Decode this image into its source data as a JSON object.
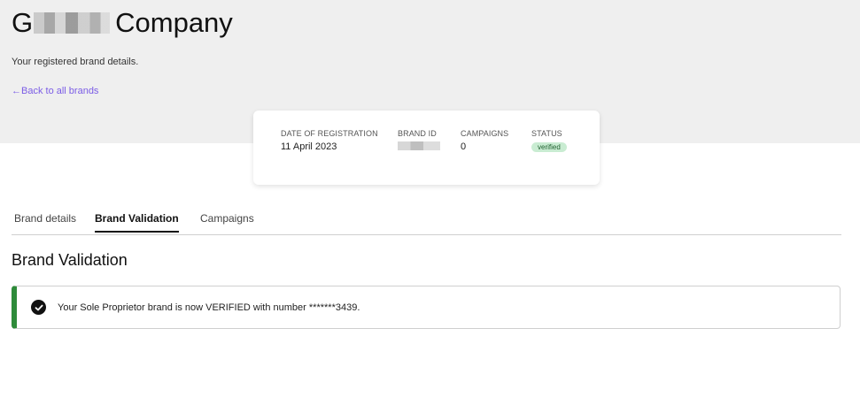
{
  "header": {
    "title_prefix": "G",
    "title_suffix": "Company",
    "subtitle": "Your registered brand details.",
    "back_link": "←Back to all brands"
  },
  "summary": {
    "registration_label": "DATE OF REGISTRATION",
    "registration_value": "11 April 2023",
    "brand_id_label": "BRAND ID",
    "campaigns_label": "CAMPAIGNS",
    "campaigns_value": "0",
    "status_label": "STATUS",
    "status_value": "verified"
  },
  "tabs": [
    {
      "label": "Brand details"
    },
    {
      "label": "Brand Validation",
      "active": true
    },
    {
      "label": "Campaigns"
    }
  ],
  "section": {
    "title": "Brand Validation"
  },
  "alert": {
    "icon": "check-circle-icon",
    "message": "Your Sole Proprietor brand is now VERIFIED with number *******3439."
  },
  "colors": {
    "accent": "#7b5ce6",
    "success": "#2e8b3a",
    "badge_bg": "#c9ecd2",
    "header_bg": "#efefef"
  }
}
